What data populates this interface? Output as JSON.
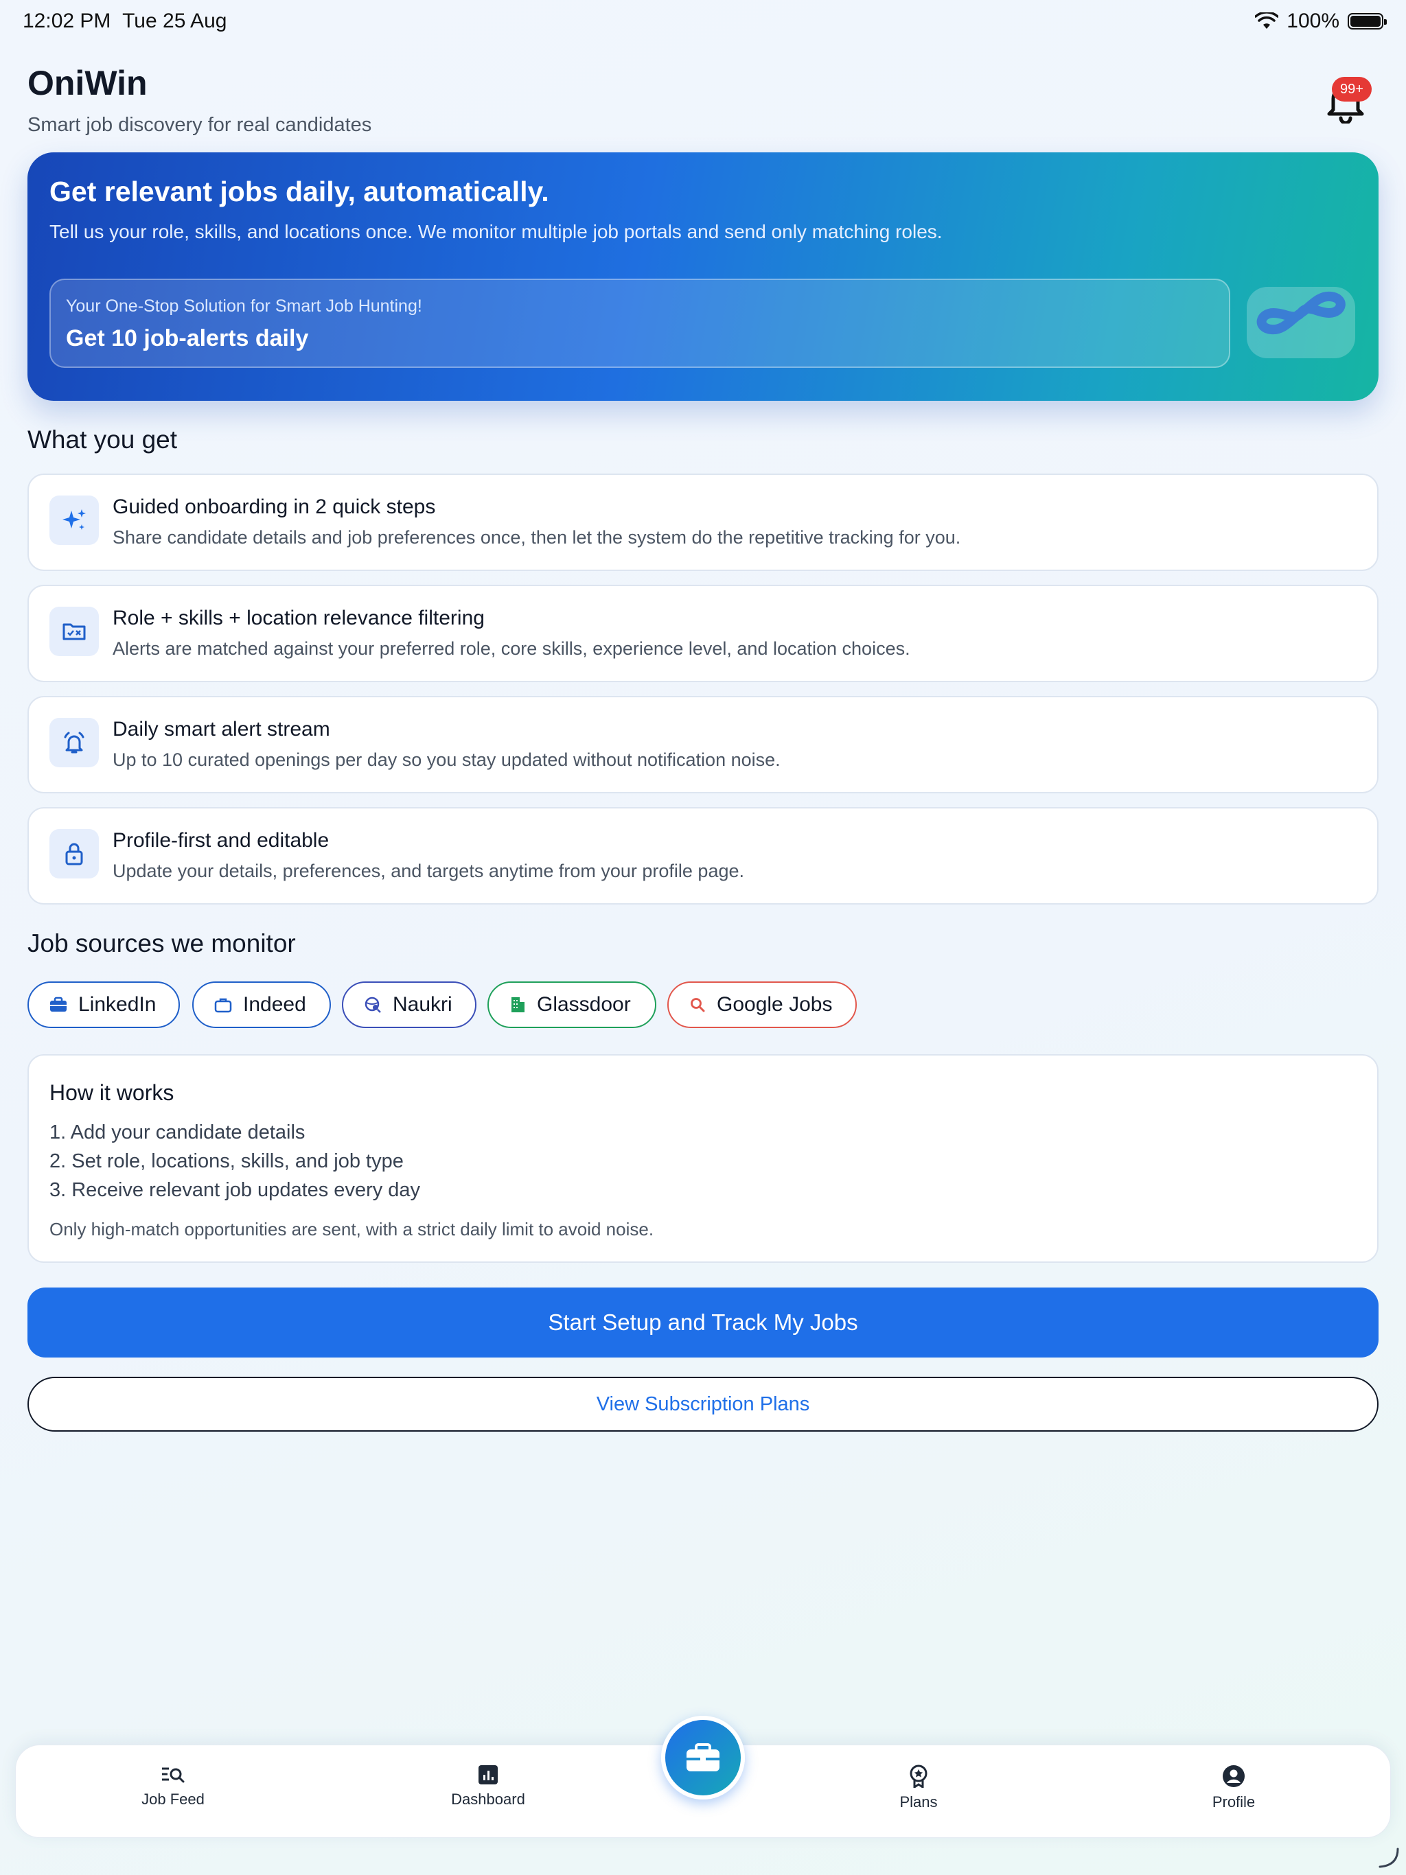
{
  "status_bar": {
    "time": "12:02 PM",
    "date": "Tue 25 Aug",
    "battery": "100%"
  },
  "header": {
    "title": "OniWin",
    "subtitle": "Smart job discovery for real candidates",
    "notification_badge": "99+"
  },
  "hero": {
    "title": "Get relevant jobs daily, automatically.",
    "text": "Tell us your role, skills, and locations once. We monitor multiple job portals and send only matching roles.",
    "box_small": "Your One-Stop Solution for Smart Job Hunting!",
    "box_big": "Get 10 job-alerts daily"
  },
  "what_you_get": {
    "heading": "What you get",
    "items": [
      {
        "icon": "sparkles-icon",
        "title": "Guided onboarding in 2 quick steps",
        "desc": "Share candidate details and job preferences once, then let the system do the repetitive tracking for you."
      },
      {
        "icon": "filter-folder-icon",
        "title": "Role + skills + location relevance filtering",
        "desc": "Alerts are matched against your preferred role, core skills, experience level, and location choices."
      },
      {
        "icon": "alarm-icon",
        "title": "Daily smart alert stream",
        "desc": "Up to 10 curated openings per day so you stay updated without notification noise."
      },
      {
        "icon": "lock-icon",
        "title": "Profile-first and editable",
        "desc": "Update your details, preferences, and targets anytime from your profile page."
      }
    ]
  },
  "sources": {
    "heading": "Job sources we monitor",
    "chips": [
      {
        "label": "LinkedIn",
        "icon": "briefcase-icon",
        "color": "#1f5fc9"
      },
      {
        "label": "Indeed",
        "icon": "bag-icon",
        "color": "#1f5fc9"
      },
      {
        "label": "Naukri",
        "icon": "globe-search-icon",
        "color": "#3b4fb8"
      },
      {
        "label": "Glassdoor",
        "icon": "building-icon",
        "color": "#1fa05a"
      },
      {
        "label": "Google Jobs",
        "icon": "search-icon",
        "color": "#e2574c"
      }
    ]
  },
  "how_it_works": {
    "title": "How it works",
    "steps": [
      "1. Add your candidate details",
      "2. Set role, locations, skills, and job type",
      "3. Receive relevant job updates every day"
    ],
    "note": "Only high-match opportunities are sent, with a strict daily limit to avoid noise."
  },
  "buttons": {
    "primary": "Start Setup and Track My Jobs",
    "secondary": "View Subscription Plans"
  },
  "bottom_nav": {
    "items": [
      {
        "label": "Job Feed",
        "icon": "job-feed-icon"
      },
      {
        "label": "Dashboard",
        "icon": "dashboard-icon"
      },
      {
        "label": "Plans",
        "icon": "award-icon"
      },
      {
        "label": "Profile",
        "icon": "profile-icon"
      }
    ],
    "center_icon": "briefcase-icon"
  },
  "colors": {
    "accent": "#1f6fe8",
    "badge": "#e53935",
    "hero_start": "#1747b8",
    "hero_end": "#16b5a3"
  }
}
